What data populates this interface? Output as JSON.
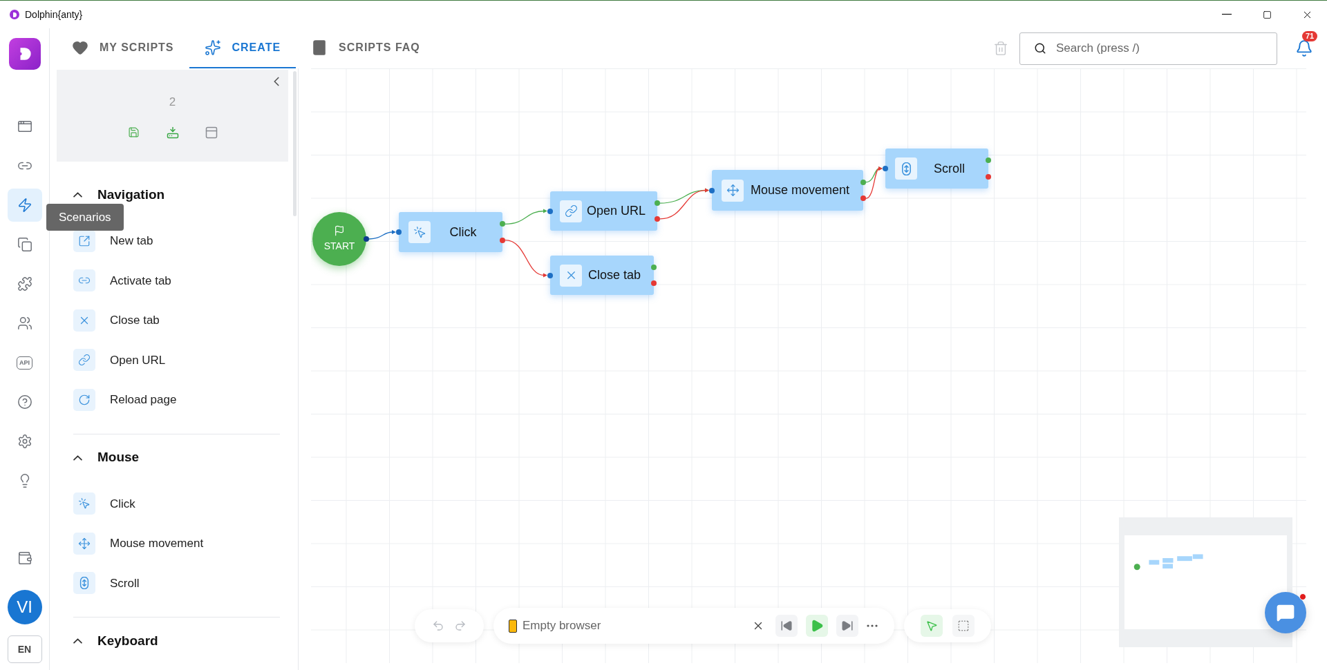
{
  "window": {
    "title": "Dolphin{anty}"
  },
  "rail": {
    "items": [
      {
        "kind": "browsers",
        "selected": false
      },
      {
        "kind": "links",
        "selected": false
      },
      {
        "kind": "scenarios",
        "selected": true
      },
      {
        "kind": "bookmarks",
        "selected": false
      },
      {
        "kind": "extensions",
        "selected": false
      },
      {
        "kind": "team",
        "selected": false
      },
      {
        "kind": "api",
        "label": "API",
        "selected": false
      },
      {
        "kind": "help",
        "selected": false
      },
      {
        "kind": "settings",
        "selected": false
      },
      {
        "kind": "ideas",
        "selected": false
      }
    ],
    "wallet": {
      "kind": "wallet"
    },
    "avatar": "VI",
    "language": "EN"
  },
  "tooltip": "Scenarios",
  "tabs": [
    {
      "label": "MY SCRIPTS",
      "selected": false
    },
    {
      "label": "CREATE",
      "selected": true
    },
    {
      "label": "SCRIPTS FAQ",
      "selected": false
    }
  ],
  "search": {
    "placeholder": "Search (press /)"
  },
  "notifications": {
    "count": "71"
  },
  "script_card": {
    "title": "2"
  },
  "sections": [
    {
      "title": "Navigation",
      "expanded": true,
      "items": [
        {
          "label": "New tab"
        },
        {
          "label": "Activate tab"
        },
        {
          "label": "Close tab"
        },
        {
          "label": "Open URL"
        },
        {
          "label": "Reload page"
        }
      ]
    },
    {
      "title": "Mouse",
      "expanded": true,
      "items": [
        {
          "label": "Click"
        },
        {
          "label": "Mouse movement"
        },
        {
          "label": "Scroll"
        }
      ]
    },
    {
      "title": "Keyboard",
      "expanded": true
    }
  ],
  "canvas": {
    "nodes": [
      {
        "kind": "start",
        "label": "START"
      },
      {
        "kind": "action",
        "label": "Click"
      },
      {
        "kind": "action",
        "label": "Open URL"
      },
      {
        "kind": "action",
        "label": "Close tab"
      },
      {
        "kind": "action",
        "label": "Mouse movement"
      },
      {
        "kind": "action",
        "label": "Scroll"
      }
    ]
  },
  "toolbar": {
    "history": [
      {
        "disabled": true
      },
      {
        "disabled": true
      }
    ],
    "browser": "Empty browser",
    "tools": [
      {
        "selected": true
      },
      {
        "selected": false
      }
    ]
  }
}
